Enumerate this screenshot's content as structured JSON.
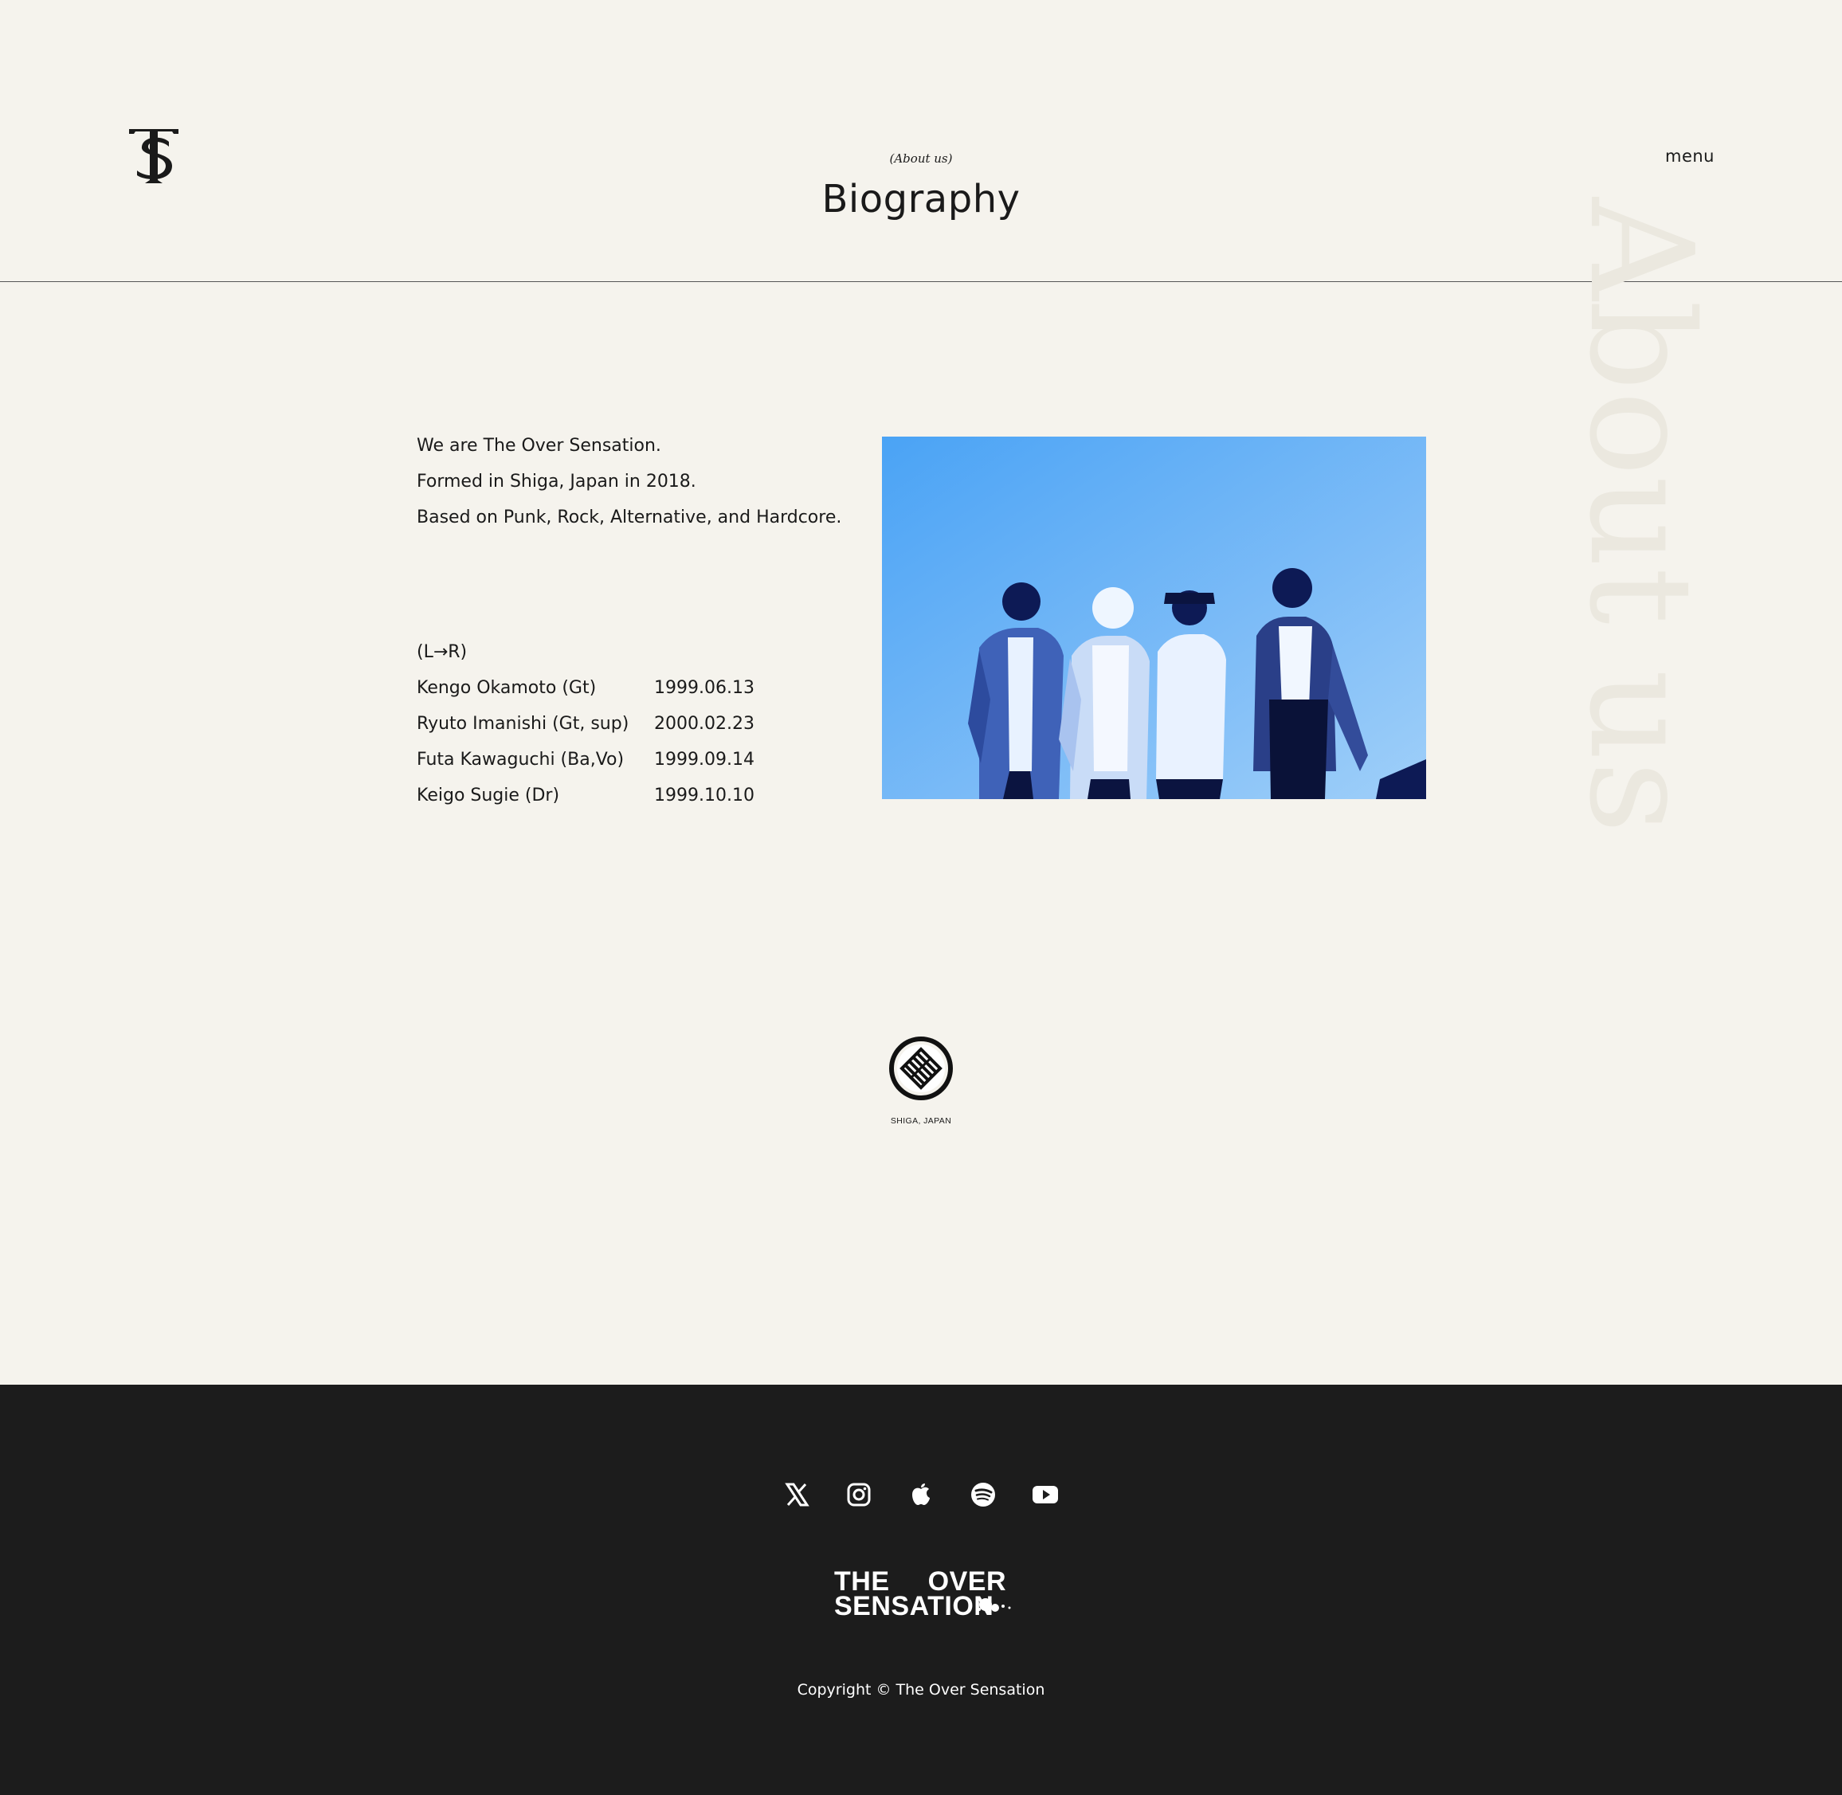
{
  "header": {
    "eyebrow": "(About us)",
    "title": "Biography",
    "menu_label": "menu",
    "logo_name": "tos-monogram-logo"
  },
  "watermark": {
    "text": "About us"
  },
  "intro": {
    "lines": [
      "We are The Over Sensation.",
      "Formed in Shiga, Japan in 2018.",
      "Based on Punk, Rock, Alternative, and Hardcore."
    ]
  },
  "members": {
    "order_label": "(L→R)",
    "rows": [
      {
        "name": "Kengo Okamoto (Gt)",
        "date": "1999.06.13"
      },
      {
        "name": "Ryuto Imanishi (Gt, sup)",
        "date": "2000.02.23"
      },
      {
        "name": "Futa Kawaguchi (Ba,Vo)",
        "date": "1999.09.14"
      },
      {
        "name": "Keigo Sugie (Dr)",
        "date": "1999.10.10"
      }
    ]
  },
  "photo": {
    "icon": "band-photo",
    "tint": "#5aa6f2"
  },
  "emblem": {
    "caption": "SHIGA, JAPAN",
    "icon": "shiga-emblem-icon"
  },
  "footer": {
    "social": [
      {
        "name": "x-icon"
      },
      {
        "name": "instagram-icon"
      },
      {
        "name": "apple-music-icon"
      },
      {
        "name": "spotify-icon"
      },
      {
        "name": "youtube-icon"
      }
    ],
    "wordmark": {
      "line1a": "THE",
      "line1b": "OVER",
      "line2": "SENSATION"
    },
    "copyright": "Copyright © The Over Sensation"
  },
  "colors": {
    "background": "#f5f3ed",
    "text": "#1a1a1a",
    "footer_bg": "#1c1c1c",
    "watermark": "#ebe8df"
  }
}
